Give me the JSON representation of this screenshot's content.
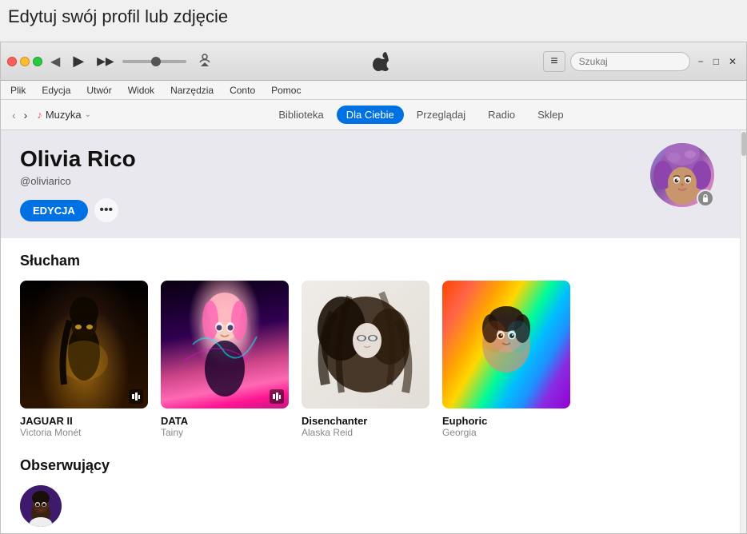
{
  "tooltip": {
    "heading": "Edytuj swój profil lub zdjęcie"
  },
  "titlebar": {
    "back_label": "◀",
    "forward_label": "▶",
    "play_label": "▶",
    "skip_label": "▶▶",
    "airplay_label": "⊙",
    "list_label": "≡",
    "search_placeholder": "Szukaj",
    "win_min": "−",
    "win_max": "□",
    "win_close": "✕"
  },
  "menubar": {
    "items": [
      {
        "label": "Plik"
      },
      {
        "label": "Edycja"
      },
      {
        "label": "Utwór"
      },
      {
        "label": "Widok"
      },
      {
        "label": "Narzędzia"
      },
      {
        "label": "Conto"
      },
      {
        "label": "Pomoc"
      }
    ]
  },
  "navbar": {
    "music_label": "Muzyka",
    "tabs": [
      {
        "id": "biblioteka",
        "label": "Biblioteka",
        "active": false
      },
      {
        "id": "dla-ciebie",
        "label": "Dla Ciebie",
        "active": true
      },
      {
        "id": "przegladaj",
        "label": "Przeglądaj",
        "active": false
      },
      {
        "id": "radio",
        "label": "Radio",
        "active": false
      },
      {
        "id": "sklep",
        "label": "Sklep",
        "active": false
      }
    ]
  },
  "profile": {
    "name": "Olivia Rico",
    "handle": "@oliviarico",
    "edit_label": "EDYCJA",
    "more_label": "•••"
  },
  "slucham": {
    "section_title": "Słucham",
    "albums": [
      {
        "id": "jaguar-ii",
        "title": "JAGUAR II",
        "artist": "Victoria Monét",
        "has_badge": true,
        "cover_type": "cover-1"
      },
      {
        "id": "data",
        "title": "DATA",
        "artist": "Tainy",
        "has_badge": true,
        "cover_type": "cover-2"
      },
      {
        "id": "disenchanter",
        "title": "Disenchanter",
        "artist": "Alaska Reid",
        "has_badge": false,
        "cover_type": "cover-3"
      },
      {
        "id": "euphoric",
        "title": "Euphoric",
        "artist": "Georgia",
        "has_badge": false,
        "cover_type": "cover-4"
      }
    ]
  },
  "obserwujacy": {
    "section_title": "Obserwujący"
  }
}
